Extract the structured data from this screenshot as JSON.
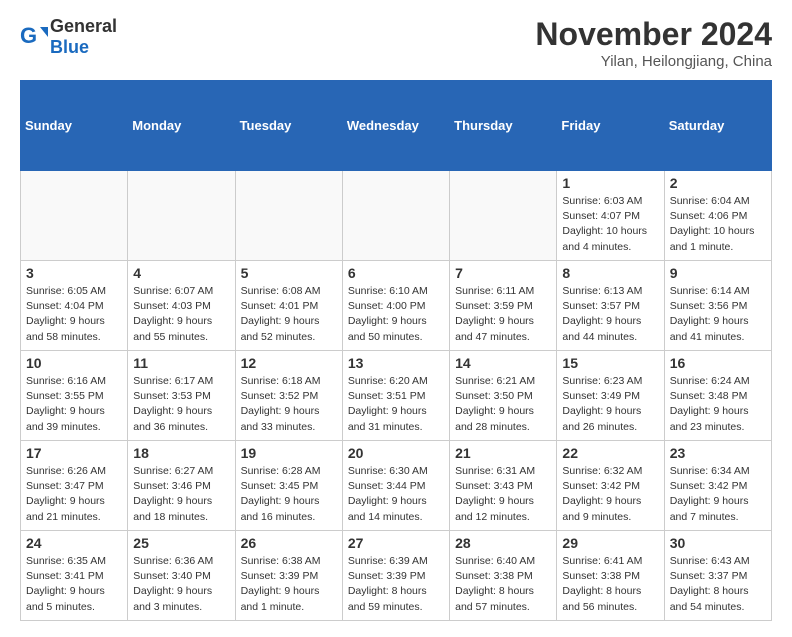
{
  "header": {
    "logo_general": "General",
    "logo_blue": "Blue",
    "title": "November 2024",
    "subtitle": "Yilan, Heilongjiang, China"
  },
  "columns": [
    "Sunday",
    "Monday",
    "Tuesday",
    "Wednesday",
    "Thursday",
    "Friday",
    "Saturday"
  ],
  "weeks": [
    [
      {
        "day": "",
        "empty": true
      },
      {
        "day": "",
        "empty": true
      },
      {
        "day": "",
        "empty": true
      },
      {
        "day": "",
        "empty": true
      },
      {
        "day": "",
        "empty": true
      },
      {
        "day": "1",
        "detail": "Sunrise: 6:03 AM\nSunset: 4:07 PM\nDaylight: 10 hours\nand 4 minutes."
      },
      {
        "day": "2",
        "detail": "Sunrise: 6:04 AM\nSunset: 4:06 PM\nDaylight: 10 hours\nand 1 minute."
      }
    ],
    [
      {
        "day": "3",
        "detail": "Sunrise: 6:05 AM\nSunset: 4:04 PM\nDaylight: 9 hours\nand 58 minutes."
      },
      {
        "day": "4",
        "detail": "Sunrise: 6:07 AM\nSunset: 4:03 PM\nDaylight: 9 hours\nand 55 minutes."
      },
      {
        "day": "5",
        "detail": "Sunrise: 6:08 AM\nSunset: 4:01 PM\nDaylight: 9 hours\nand 52 minutes."
      },
      {
        "day": "6",
        "detail": "Sunrise: 6:10 AM\nSunset: 4:00 PM\nDaylight: 9 hours\nand 50 minutes."
      },
      {
        "day": "7",
        "detail": "Sunrise: 6:11 AM\nSunset: 3:59 PM\nDaylight: 9 hours\nand 47 minutes."
      },
      {
        "day": "8",
        "detail": "Sunrise: 6:13 AM\nSunset: 3:57 PM\nDaylight: 9 hours\nand 44 minutes."
      },
      {
        "day": "9",
        "detail": "Sunrise: 6:14 AM\nSunset: 3:56 PM\nDaylight: 9 hours\nand 41 minutes."
      }
    ],
    [
      {
        "day": "10",
        "detail": "Sunrise: 6:16 AM\nSunset: 3:55 PM\nDaylight: 9 hours\nand 39 minutes."
      },
      {
        "day": "11",
        "detail": "Sunrise: 6:17 AM\nSunset: 3:53 PM\nDaylight: 9 hours\nand 36 minutes."
      },
      {
        "day": "12",
        "detail": "Sunrise: 6:18 AM\nSunset: 3:52 PM\nDaylight: 9 hours\nand 33 minutes."
      },
      {
        "day": "13",
        "detail": "Sunrise: 6:20 AM\nSunset: 3:51 PM\nDaylight: 9 hours\nand 31 minutes."
      },
      {
        "day": "14",
        "detail": "Sunrise: 6:21 AM\nSunset: 3:50 PM\nDaylight: 9 hours\nand 28 minutes."
      },
      {
        "day": "15",
        "detail": "Sunrise: 6:23 AM\nSunset: 3:49 PM\nDaylight: 9 hours\nand 26 minutes."
      },
      {
        "day": "16",
        "detail": "Sunrise: 6:24 AM\nSunset: 3:48 PM\nDaylight: 9 hours\nand 23 minutes."
      }
    ],
    [
      {
        "day": "17",
        "detail": "Sunrise: 6:26 AM\nSunset: 3:47 PM\nDaylight: 9 hours\nand 21 minutes."
      },
      {
        "day": "18",
        "detail": "Sunrise: 6:27 AM\nSunset: 3:46 PM\nDaylight: 9 hours\nand 18 minutes."
      },
      {
        "day": "19",
        "detail": "Sunrise: 6:28 AM\nSunset: 3:45 PM\nDaylight: 9 hours\nand 16 minutes."
      },
      {
        "day": "20",
        "detail": "Sunrise: 6:30 AM\nSunset: 3:44 PM\nDaylight: 9 hours\nand 14 minutes."
      },
      {
        "day": "21",
        "detail": "Sunrise: 6:31 AM\nSunset: 3:43 PM\nDaylight: 9 hours\nand 12 minutes."
      },
      {
        "day": "22",
        "detail": "Sunrise: 6:32 AM\nSunset: 3:42 PM\nDaylight: 9 hours\nand 9 minutes."
      },
      {
        "day": "23",
        "detail": "Sunrise: 6:34 AM\nSunset: 3:42 PM\nDaylight: 9 hours\nand 7 minutes."
      }
    ],
    [
      {
        "day": "24",
        "detail": "Sunrise: 6:35 AM\nSunset: 3:41 PM\nDaylight: 9 hours\nand 5 minutes."
      },
      {
        "day": "25",
        "detail": "Sunrise: 6:36 AM\nSunset: 3:40 PM\nDaylight: 9 hours\nand 3 minutes."
      },
      {
        "day": "26",
        "detail": "Sunrise: 6:38 AM\nSunset: 3:39 PM\nDaylight: 9 hours\nand 1 minute."
      },
      {
        "day": "27",
        "detail": "Sunrise: 6:39 AM\nSunset: 3:39 PM\nDaylight: 8 hours\nand 59 minutes."
      },
      {
        "day": "28",
        "detail": "Sunrise: 6:40 AM\nSunset: 3:38 PM\nDaylight: 8 hours\nand 57 minutes."
      },
      {
        "day": "29",
        "detail": "Sunrise: 6:41 AM\nSunset: 3:38 PM\nDaylight: 8 hours\nand 56 minutes."
      },
      {
        "day": "30",
        "detail": "Sunrise: 6:43 AM\nSunset: 3:37 PM\nDaylight: 8 hours\nand 54 minutes."
      }
    ]
  ]
}
